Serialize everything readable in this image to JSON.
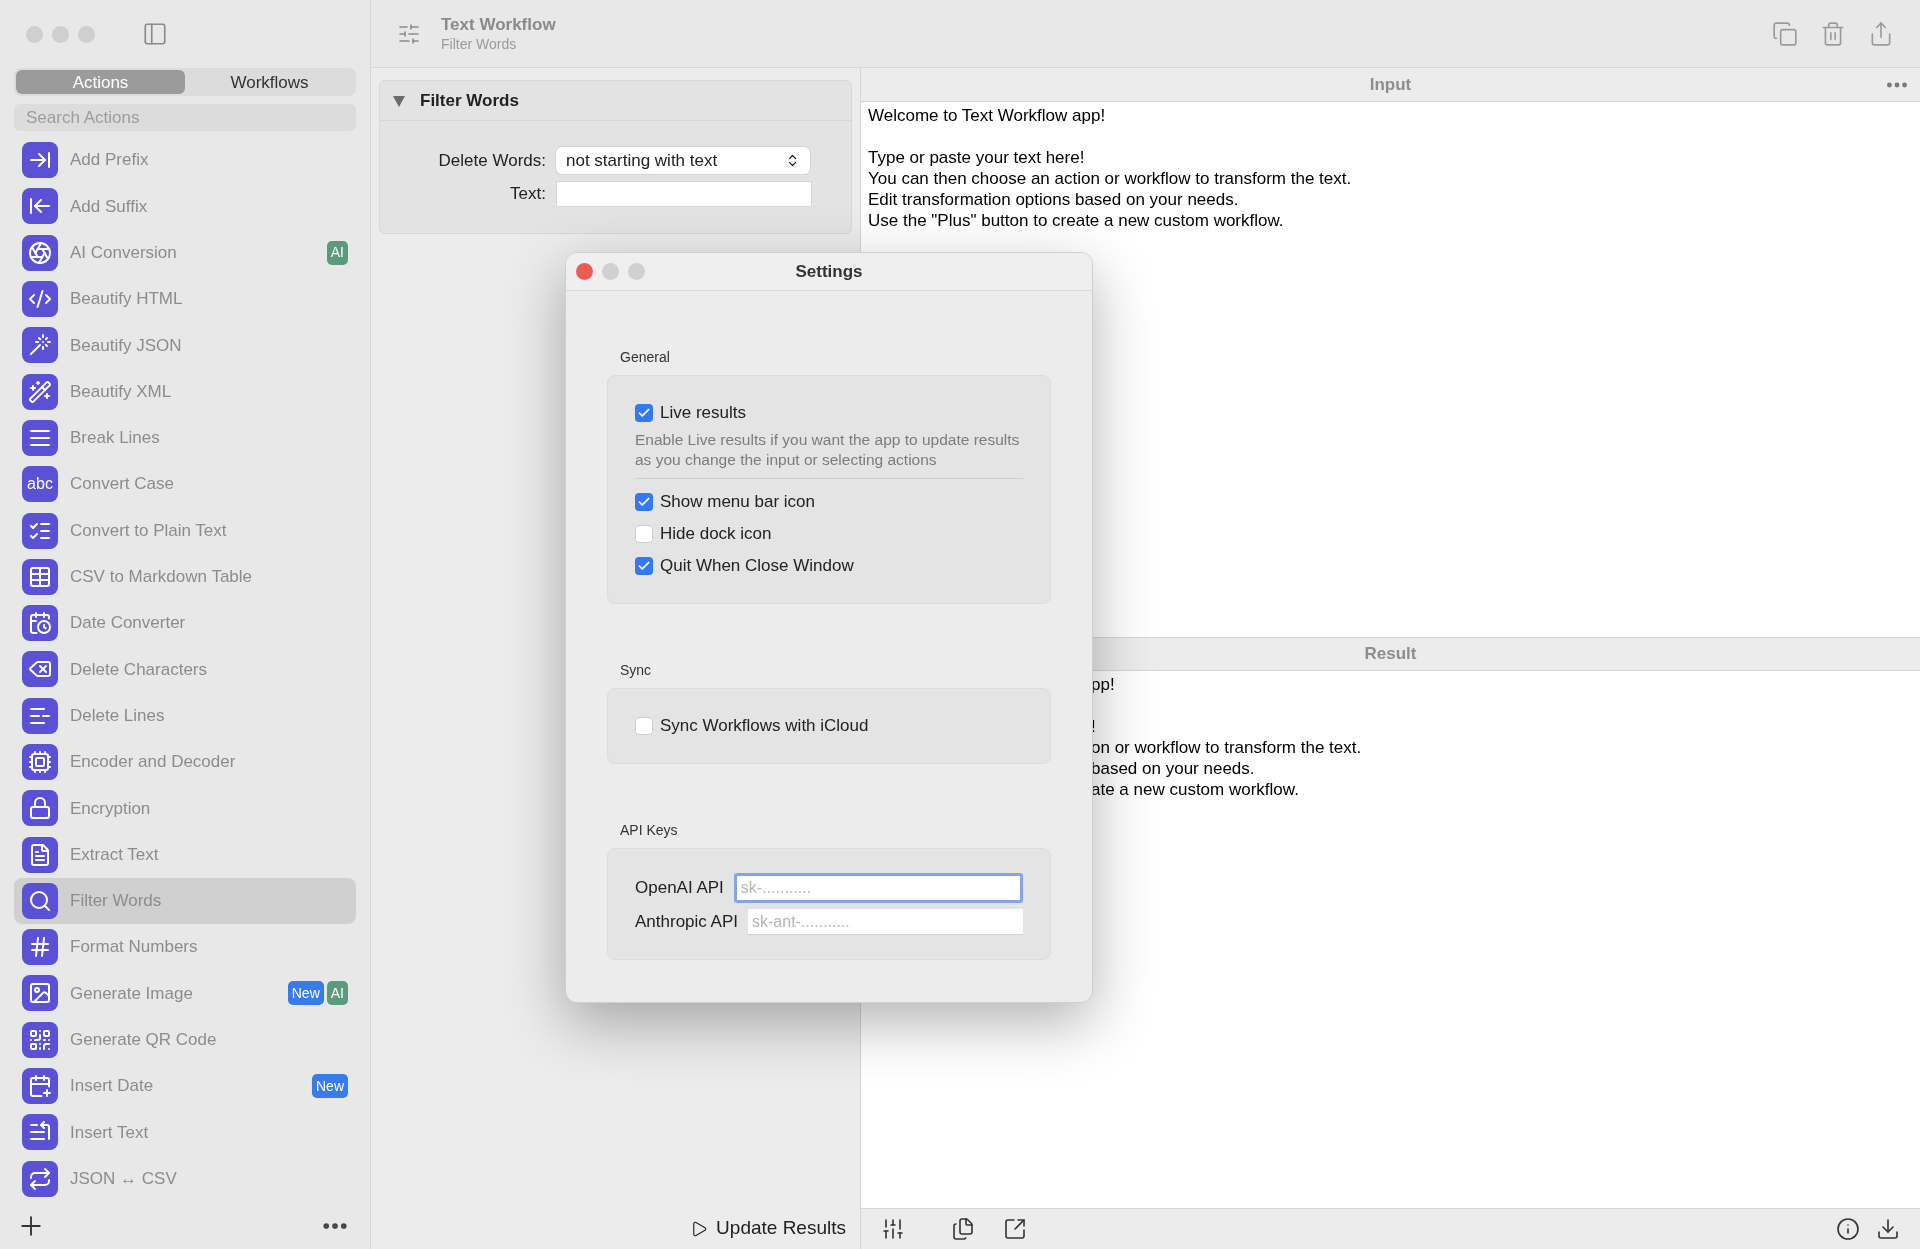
{
  "sidebar": {
    "tabs": [
      {
        "label": "Actions",
        "selected": true
      },
      {
        "label": "Workflows",
        "selected": false
      }
    ],
    "search": {
      "placeholder": "Search Actions"
    },
    "items": [
      {
        "label": "Add Prefix",
        "selected": false
      },
      {
        "label": "Add Suffix",
        "selected": false
      },
      {
        "label": "AI Conversion",
        "selected": false,
        "badges": [
          {
            "label": "AI",
            "color": "#5b9a7c"
          }
        ]
      },
      {
        "label": "Beautify HTML",
        "selected": false
      },
      {
        "label": "Beautify JSON",
        "selected": false
      },
      {
        "label": "Beautify XML",
        "selected": false
      },
      {
        "label": "Break Lines",
        "selected": false
      },
      {
        "label": "Convert Case",
        "selected": false,
        "icon_text": "abc"
      },
      {
        "label": "Convert to Plain Text",
        "selected": false
      },
      {
        "label": "CSV to Markdown Table",
        "selected": false
      },
      {
        "label": "Date Converter",
        "selected": false
      },
      {
        "label": "Delete Characters",
        "selected": false
      },
      {
        "label": "Delete Lines",
        "selected": false
      },
      {
        "label": "Encoder and Decoder",
        "selected": false
      },
      {
        "label": "Encryption",
        "selected": false
      },
      {
        "label": "Extract Text",
        "selected": false
      },
      {
        "label": "Filter Words",
        "selected": true
      },
      {
        "label": "Format Numbers",
        "selected": false
      },
      {
        "label": "Generate Image",
        "selected": false,
        "badges": [
          {
            "label": "New",
            "color": "#3a7bea"
          },
          {
            "label": "AI",
            "color": "#5b9a7c"
          }
        ]
      },
      {
        "label": "Generate QR Code",
        "selected": false
      },
      {
        "label": "Insert Date",
        "selected": false,
        "badges": [
          {
            "label": "New",
            "color": "#3a7bea"
          }
        ]
      },
      {
        "label": "Insert Text",
        "selected": false
      },
      {
        "label": "JSON ↔ CSV",
        "selected": false
      }
    ]
  },
  "toolbar": {
    "title": "Text Workflow",
    "subtitle": "Filter Words"
  },
  "action_panel": {
    "title": "Filter Words",
    "expanded": true,
    "fields": [
      {
        "kind": "select",
        "label": "Delete Words:",
        "value": "not starting with text"
      },
      {
        "kind": "text",
        "label": "Text:"
      }
    ]
  },
  "update_button": {
    "label": "Update Results"
  },
  "input": {
    "title": "Input",
    "text": "Welcome to Text Workflow app!\n\nType or paste your text here!\nYou can then choose an action or workflow to transform the text.\nEdit transformation options based on your needs.\nUse the \"Plus\" button to create a new custom workflow."
  },
  "result": {
    "title": "Result",
    "text": "pp!\n\n!\non or workflow to transform the text.\nbased on your needs.\nate a new custom workflow."
  },
  "settings": {
    "title": "Settings",
    "sections": [
      {
        "title": "General",
        "items": [
          {
            "kind": "checkbox",
            "label": "Live results",
            "checked": true,
            "description": "Enable Live results if you want the app to update results as you change the input or selecting actions"
          },
          {
            "kind": "checkbox",
            "label": "Show menu bar icon",
            "checked": true
          },
          {
            "kind": "checkbox",
            "label": "Hide dock icon",
            "checked": false
          },
          {
            "kind": "checkbox",
            "label": "Quit When Close Window",
            "checked": true
          }
        ]
      },
      {
        "title": "Sync",
        "items": [
          {
            "kind": "checkbox",
            "label": "Sync Workflows with iCloud",
            "checked": false
          }
        ]
      },
      {
        "title": "API Keys",
        "items": [
          {
            "kind": "field",
            "label": "OpenAI API",
            "placeholder": "sk-...........",
            "focused": true
          },
          {
            "kind": "field",
            "label": "Anthropic API",
            "placeholder": "sk-ant-...........",
            "focused": false
          }
        ]
      }
    ]
  }
}
